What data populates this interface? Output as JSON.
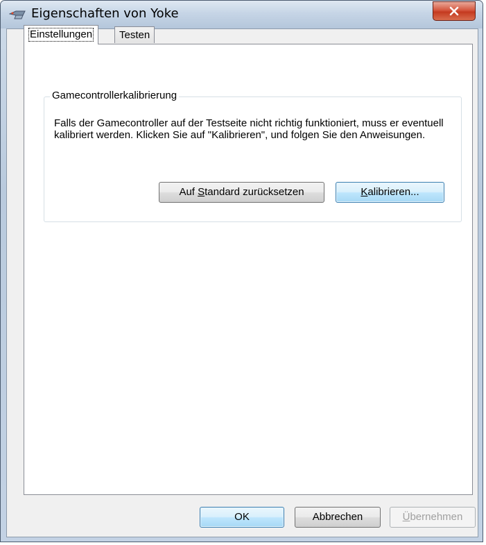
{
  "window": {
    "title": "Eigenschaften von Yoke"
  },
  "tabs": [
    {
      "label": "Einstellungen",
      "active": true
    },
    {
      "label": "Testen",
      "active": false
    }
  ],
  "group": {
    "title": "Gamecontrollerkalibrierung",
    "text": "Falls der Gamecontroller auf der Testseite nicht richtig funktioniert, muss er eventuell kalibriert werden. Klicken Sie auf \"Kalibrieren\", und folgen Sie den Anweisungen."
  },
  "buttons": {
    "reset": {
      "prefix": "Auf ",
      "accel": "S",
      "suffix": "tandard zurücksetzen"
    },
    "calibrate": {
      "prefix": "",
      "accel": "K",
      "suffix": "alibrieren..."
    },
    "ok": "OK",
    "cancel": "Abbrechen",
    "apply": {
      "prefix": "",
      "accel": "Ü",
      "suffix": "bernehmen"
    }
  },
  "colors": {
    "accent": "#3c7fb1",
    "close": "#c43a20"
  }
}
